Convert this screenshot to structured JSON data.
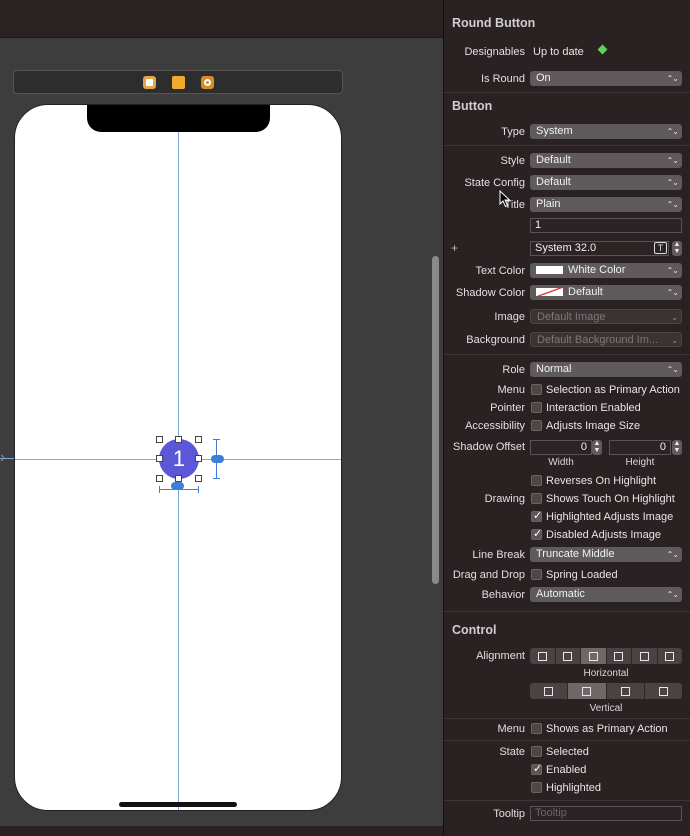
{
  "canvas": {
    "button_title": "1"
  },
  "inspector": {
    "round_button": {
      "title": "Round Button",
      "designables_label": "Designables",
      "designables_value": "Up to date",
      "is_round_label": "Is Round",
      "is_round_value": "On"
    },
    "button": {
      "title": "Button",
      "type_label": "Type",
      "type_value": "System",
      "style_label": "Style",
      "style_value": "Default",
      "state_config_label": "State Config",
      "state_config_value": "Default",
      "title_label": "Title",
      "title_value": "Plain",
      "title_text": "1",
      "font_value": "System 32.0",
      "text_color_label": "Text Color",
      "text_color_value": "White Color",
      "shadow_color_label": "Shadow Color",
      "shadow_color_value": "Default",
      "image_label": "Image",
      "image_placeholder": "Default Image",
      "background_label": "Background",
      "background_placeholder": "Default Background Im...",
      "role_label": "Role",
      "role_value": "Normal",
      "menu_label": "Menu",
      "menu_option": "Selection as Primary Action",
      "pointer_label": "Pointer",
      "pointer_option": "Interaction Enabled",
      "accessibility_label": "Accessibility",
      "accessibility_option": "Adjusts Image Size",
      "shadow_offset_label": "Shadow Offset",
      "shadow_width_value": "0",
      "shadow_height_value": "0",
      "width_label": "Width",
      "height_label": "Height",
      "reverses_label": "Reverses On Highlight",
      "drawing_label": "Drawing",
      "shows_touch_label": "Shows Touch On Highlight",
      "highlighted_adjusts_label": "Highlighted Adjusts Image",
      "disabled_adjusts_label": "Disabled Adjusts Image",
      "line_break_label": "Line Break",
      "line_break_value": "Truncate Middle",
      "drag_drop_label": "Drag and Drop",
      "spring_loaded_label": "Spring Loaded",
      "behavior_label": "Behavior",
      "behavior_value": "Automatic"
    },
    "control": {
      "title": "Control",
      "alignment_label": "Alignment",
      "horizontal_label": "Horizontal",
      "vertical_label": "Vertical",
      "menu_label": "Menu",
      "menu_option": "Shows as Primary Action",
      "state_label": "State",
      "selected_label": "Selected",
      "enabled_label": "Enabled",
      "highlighted_label": "Highlighted"
    },
    "tooltip": {
      "label": "Tooltip",
      "placeholder": "Tooltip"
    }
  },
  "colors": {
    "button_fill": "#5b57d6",
    "constraint_blue": "#3d7fd8",
    "guide_blue": "#7fa8d8",
    "designable_green": "#5ed35a"
  }
}
